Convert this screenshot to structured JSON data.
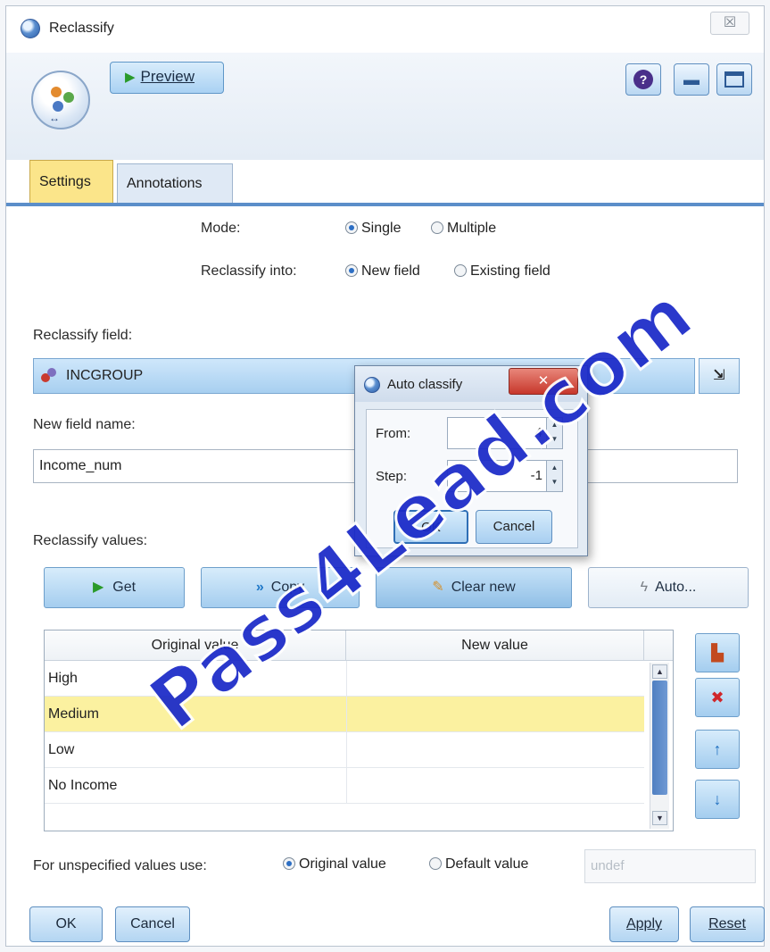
{
  "window": {
    "title": "Reclassify",
    "close_glyph": "☒"
  },
  "toolbar": {
    "preview_label": "Preview",
    "help_glyph": "?",
    "minimize_glyph": "▬"
  },
  "tabs": [
    {
      "label": "Settings"
    },
    {
      "label": "Annotations"
    }
  ],
  "settings": {
    "mode_label": "Mode:",
    "mode_options": [
      {
        "label": "Single",
        "selected": true
      },
      {
        "label": "Multiple",
        "selected": false
      }
    ],
    "reclassify_into_label": "Reclassify into:",
    "reclassify_into_options": [
      {
        "label": "New field",
        "selected": true
      },
      {
        "label": "Existing field",
        "selected": false
      }
    ],
    "reclassify_field_label": "Reclassify field:",
    "reclassify_field_value": "INCGROUP",
    "field_picker_glyph": "⇲",
    "new_field_name_label": "New field name:",
    "new_field_name_value": "Income_num",
    "reclassify_values_label": "Reclassify values:",
    "buttons": {
      "get": "Get",
      "copy": "Copy",
      "clear_new": "Clear new",
      "auto": "Auto..."
    },
    "table": {
      "columns": [
        "Original value",
        "New value"
      ],
      "rows": [
        {
          "original": "High",
          "new": ""
        },
        {
          "original": "Medium",
          "new": "",
          "selected": true
        },
        {
          "original": "Low",
          "new": ""
        },
        {
          "original": "No Income",
          "new": ""
        }
      ]
    },
    "unspecified_label": "For unspecified values use:",
    "unspecified_options": [
      {
        "label": "Original value",
        "selected": true
      },
      {
        "label": "Default value",
        "selected": false
      }
    ],
    "default_value_placeholder": "undef"
  },
  "footer": {
    "ok": "OK",
    "cancel": "Cancel",
    "apply": "Apply",
    "reset": "Reset"
  },
  "auto_classify_dialog": {
    "title": "Auto classify",
    "close_glyph": "✕",
    "from_label": "From:",
    "from_value": "4",
    "step_label": "Step:",
    "step_value": "-1",
    "ok": "OK",
    "cancel": "Cancel"
  },
  "watermark": "Pass4Lead.com",
  "colors": {
    "accent": "#5b8ec9",
    "selected_row": "#fbf1a0",
    "settings_tab": "#fbe58a",
    "watermark": "#1a29c8"
  }
}
